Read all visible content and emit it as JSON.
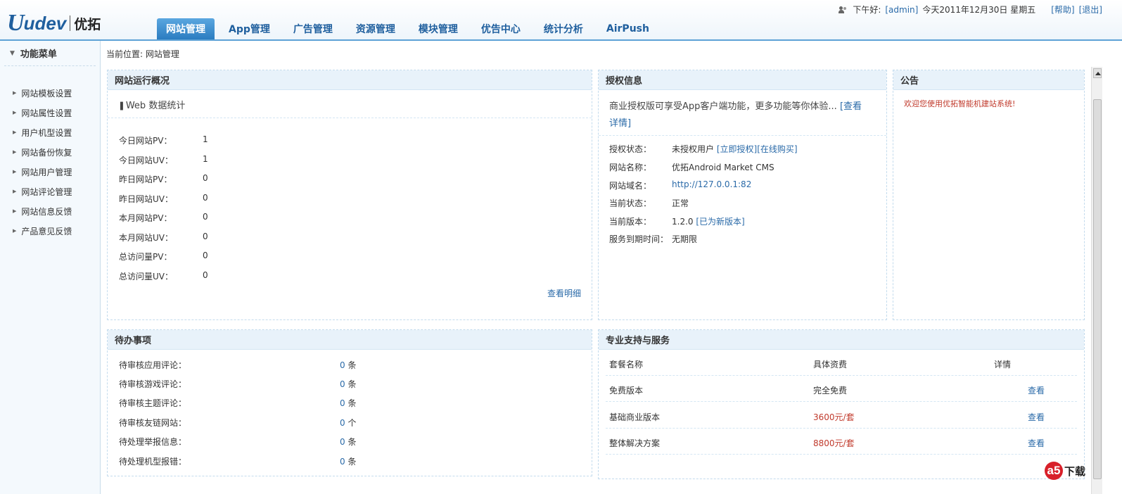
{
  "logo": {
    "text1": "U",
    "text2": "udev",
    "text3": "优拓"
  },
  "userbar": {
    "greeting": "下午好:",
    "user": "[admin]",
    "date": "今天2011年12月30日 星期五",
    "help": "[帮助]",
    "logout": "[退出]"
  },
  "nav": {
    "tabs": [
      "网站管理",
      "App管理",
      "广告管理",
      "资源管理",
      "模块管理",
      "优告中心",
      "统计分析",
      "AirPush"
    ],
    "active": 0
  },
  "sidebar": {
    "title": "功能菜单",
    "items": [
      "网站模板设置",
      "网站属性设置",
      "用户机型设置",
      "网站备份恢复",
      "网站用户管理",
      "网站评论管理",
      "网站信息反馈",
      "产品意见反馈"
    ]
  },
  "breadcrumb": "当前位置: 网站管理",
  "overview": {
    "title": "网站运行概况",
    "subtitle": "Web 数据统计",
    "rows": [
      [
        "今日网站PV：",
        "1"
      ],
      [
        "今日网站UV：",
        "1"
      ],
      [
        "昨日网站PV：",
        "0"
      ],
      [
        "昨日网站UV：",
        "0"
      ],
      [
        "本月网站PV：",
        "0"
      ],
      [
        "本月网站UV：",
        "0"
      ],
      [
        "总访问量PV：",
        "0"
      ],
      [
        "总访问量UV：",
        "0"
      ]
    ],
    "more": "查看明细"
  },
  "license": {
    "title": "授权信息",
    "notice": "商业授权版可享受App客户端功能，更多功能等你体验...",
    "notice_link1": "[查看",
    "notice_link2": "详情]",
    "status_label": "授权状态：",
    "status_value": "未授权用户",
    "status_link1": "[立即授权]",
    "status_link2": "[在线购买]",
    "name_label": "网站名称：",
    "name_value": "优拓Android Market CMS",
    "domain_label": "网站域名：",
    "domain_value": "http://127.0.0.1:82",
    "state_label": "当前状态：",
    "state_value": "正常",
    "version_label": "当前版本：",
    "version_value": "1.2.0",
    "version_link": "[已为新版本]",
    "expire_label": "服务到期时间：",
    "expire_value": "无期限"
  },
  "announcement": {
    "title": "公告",
    "text": "欢迎您使用优拓智能机建站系统!"
  },
  "todo": {
    "title": "待办事项",
    "rows": [
      [
        "待审核应用评论：",
        "0",
        "条"
      ],
      [
        "待审核游戏评论：",
        "0",
        "条"
      ],
      [
        "待审核主题评论：",
        "0",
        "条"
      ],
      [
        "待审核友链网站：",
        "0",
        "个"
      ],
      [
        "待处理举报信息：",
        "0",
        "条"
      ],
      [
        "待处理机型报错：",
        "0",
        "条"
      ]
    ]
  },
  "support": {
    "title": "专业支持与服务",
    "headers": [
      "套餐名称",
      "具体资费",
      "详情"
    ],
    "rows": [
      [
        "免费版本",
        "完全免费",
        "查看"
      ],
      [
        "基础商业版本",
        "3600元/套",
        "查看"
      ],
      [
        "整体解决方案",
        "8800元/套",
        "查看"
      ]
    ]
  },
  "watermark": {
    "badge": "a5",
    "text": "下载"
  }
}
